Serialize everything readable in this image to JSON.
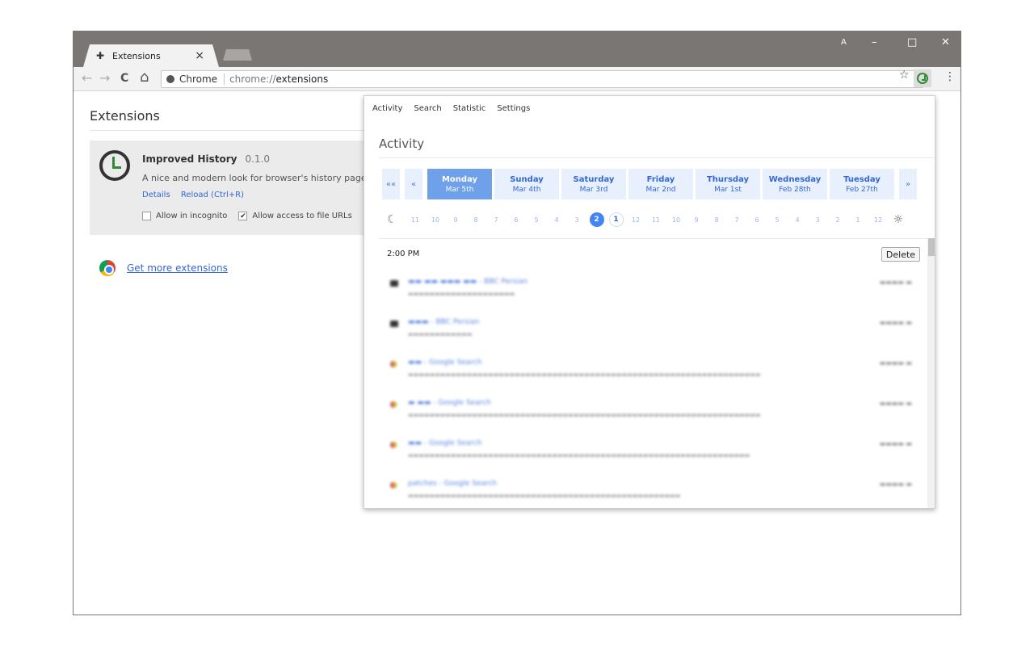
{
  "window": {
    "tab_title": "Extensions",
    "tab_close": "×",
    "controls": {
      "profile": "A",
      "minimize": "–",
      "maximize": "□",
      "close": "✕"
    }
  },
  "toolbar": {
    "back": "←",
    "forward": "→",
    "reload": "C",
    "home": "⌂",
    "omnibox_chip": "Chrome",
    "omnibox_url_prefix": "chrome://",
    "omnibox_url_main": "extensions",
    "star": "☆",
    "menu": "⋮"
  },
  "page": {
    "title": "Extensions",
    "extension": {
      "name": "Improved History",
      "version": "0.1.0",
      "description": "A nice and modern look for browser's history page.",
      "links": [
        "Details",
        "Reload (Ctrl+R)"
      ],
      "options": [
        {
          "label": "Allow in incognito",
          "checked": false
        },
        {
          "label": "Allow access to file URLs",
          "checked": true
        }
      ]
    },
    "more_extensions": "Get more extensions"
  },
  "popup": {
    "tabs": [
      "Activity",
      "Search",
      "Statistic",
      "Settings"
    ],
    "title": "Activity",
    "nav_first": "««",
    "nav_prev": "«",
    "nav_next": "»",
    "days": [
      {
        "name": "Monday",
        "date": "Mar 5th",
        "active": true
      },
      {
        "name": "Sunday",
        "date": "Mar 4th",
        "active": false
      },
      {
        "name": "Saturday",
        "date": "Mar 3rd",
        "active": false
      },
      {
        "name": "Friday",
        "date": "Mar 2nd",
        "active": false
      },
      {
        "name": "Thursday",
        "date": "Mar 1st",
        "active": false
      },
      {
        "name": "Wednesday",
        "date": "Feb 28th",
        "active": false
      },
      {
        "name": "Tuesday",
        "date": "Feb 27th",
        "active": false
      }
    ],
    "hours_pm": [
      "11",
      "10",
      "9",
      "8",
      "7",
      "6",
      "5",
      "4",
      "3",
      "2",
      "1"
    ],
    "hours_am": [
      "12",
      "11",
      "10",
      "9",
      "8",
      "7",
      "6",
      "5",
      "4",
      "3",
      "2",
      "1",
      "12"
    ],
    "selected_hour": "2",
    "time_heading": "2:00 PM",
    "delete_label": "Delete",
    "entries": [
      {
        "icon": "site",
        "title": "▬▬ ▬▬ ▬▬▬ ▬▬ - BBC Persian",
        "url": "▬▬▬▬▬▬▬▬▬▬▬▬▬▬▬▬▬▬▬▬",
        "time": "▬▬▬▬ ▬"
      },
      {
        "icon": "site",
        "title": "▬▬▬ - BBC Persian",
        "url": "▬▬▬▬▬▬▬▬▬▬▬▬",
        "time": "▬▬▬▬ ▬"
      },
      {
        "icon": "google",
        "title": "▬▬ - Google Search",
        "url": "▬▬▬▬▬▬▬▬▬▬▬▬▬▬▬▬▬▬▬▬▬▬▬▬▬▬▬▬▬▬▬▬▬▬▬▬▬▬▬▬▬▬▬▬▬▬▬▬▬▬▬▬▬▬▬▬▬▬▬▬▬▬▬▬▬▬",
        "time": "▬▬▬▬ ▬"
      },
      {
        "icon": "google",
        "title": "▬ ▬▬ - Google Search",
        "url": "▬▬▬▬▬▬▬▬▬▬▬▬▬▬▬▬▬▬▬▬▬▬▬▬▬▬▬▬▬▬▬▬▬▬▬▬▬▬▬▬▬▬▬▬▬▬▬▬▬▬▬▬▬▬▬▬▬▬▬▬▬▬▬▬▬▬",
        "time": "▬▬▬▬ ▬"
      },
      {
        "icon": "google",
        "title": "▬▬ - Google Search",
        "url": "▬▬▬▬▬▬▬▬▬▬▬▬▬▬▬▬▬▬▬▬▬▬▬▬▬▬▬▬▬▬▬▬▬▬▬▬▬▬▬▬▬▬▬▬▬▬▬▬▬▬▬▬▬▬▬▬▬▬▬▬▬▬▬▬",
        "time": "▬▬▬▬ ▬"
      },
      {
        "icon": "google",
        "title": "patches - Google Search",
        "url": "▬▬▬▬▬▬▬▬▬▬▬▬▬▬▬▬▬▬▬▬▬▬▬▬▬▬▬▬▬▬▬▬▬▬▬▬▬▬▬▬▬▬▬▬▬▬▬▬▬▬▬",
        "time": "▬▬▬▬ ▬"
      }
    ]
  },
  "colors": {
    "titlebar": "#7a7674",
    "accent": "#3367d6",
    "active_day": "#6fa0ea",
    "day_bg": "#e8f0fe",
    "selected_hour": "#4285f4"
  }
}
